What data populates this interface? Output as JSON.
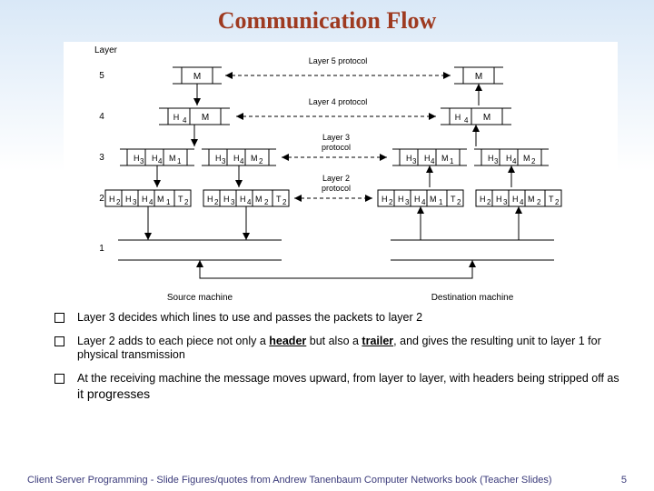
{
  "title": "Communication Flow",
  "diagram": {
    "col_layer_header": "Layer",
    "layers": [
      "5",
      "4",
      "3",
      "2",
      "1"
    ],
    "protocol_labels": {
      "l5": "Layer 5 protocol",
      "l4": "Layer 4 protocol",
      "l3": "Layer 3\nprotocol",
      "l2": "Layer 2\nprotocol"
    },
    "machines": {
      "source": "Source machine",
      "dest": "Destination machine"
    },
    "row5": {
      "left": [
        "M"
      ],
      "right": [
        "M"
      ]
    },
    "row4": {
      "left": [
        "H4",
        "M"
      ],
      "right": [
        "H4",
        "M"
      ]
    },
    "row3": {
      "left_a": [
        "H3",
        "H4",
        "M1"
      ],
      "left_b": [
        "H3",
        "H4",
        "M2"
      ],
      "right_a": [
        "H3",
        "H4",
        "M1"
      ],
      "right_b": [
        "H3",
        "H4",
        "M2"
      ]
    },
    "row2": {
      "left_a": [
        "H2",
        "H3",
        "H4",
        "M1",
        "T2"
      ],
      "left_b": [
        "H2",
        "H3",
        "H4",
        "M2",
        "T2"
      ],
      "right_a": [
        "H2",
        "H3",
        "H4",
        "M1",
        "T2"
      ],
      "right_b": [
        "H2",
        "H3",
        "H4",
        "M2",
        "T2"
      ]
    }
  },
  "bullets": {
    "b1": "Layer 3 decides which lines to use and passes the packets to layer 2",
    "b2_pre": "Layer 2 adds to each piece not only a ",
    "b2_hdr": "header",
    "b2_mid": " but also a ",
    "b2_trl": "trailer",
    "b2_post": ", and gives the resulting unit to layer 1 for physical transmission",
    "b3_pre": "At the receiving machine the message moves upward, from layer to layer, with headers being stripped off as ",
    "b3_big": "it progresses"
  },
  "footer": {
    "left": "Client Server Programming    - Slide Figures/quotes from Andrew Tanenbaum Computer Networks book (Teacher Slides)",
    "page": "5"
  }
}
